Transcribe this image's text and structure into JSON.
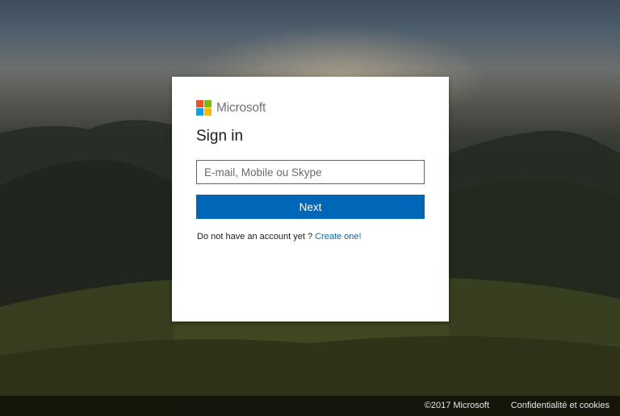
{
  "brand": {
    "name": "Microsoft",
    "logo_colors": [
      "#f25022",
      "#7fba00",
      "#00a4ef",
      "#ffb900"
    ]
  },
  "signin": {
    "title": "Sign in",
    "email_placeholder": "E-mail, Mobile ou Skype",
    "email_value": "",
    "next_label": "Next",
    "no_account_text": "Do not have an account yet ?",
    "create_link": "Create one!"
  },
  "footer": {
    "copyright": "©2017 Microsoft",
    "privacy_link": "Confidentialité et cookies"
  },
  "colors": {
    "accent": "#0067b8",
    "card_background": "#ffffff"
  }
}
